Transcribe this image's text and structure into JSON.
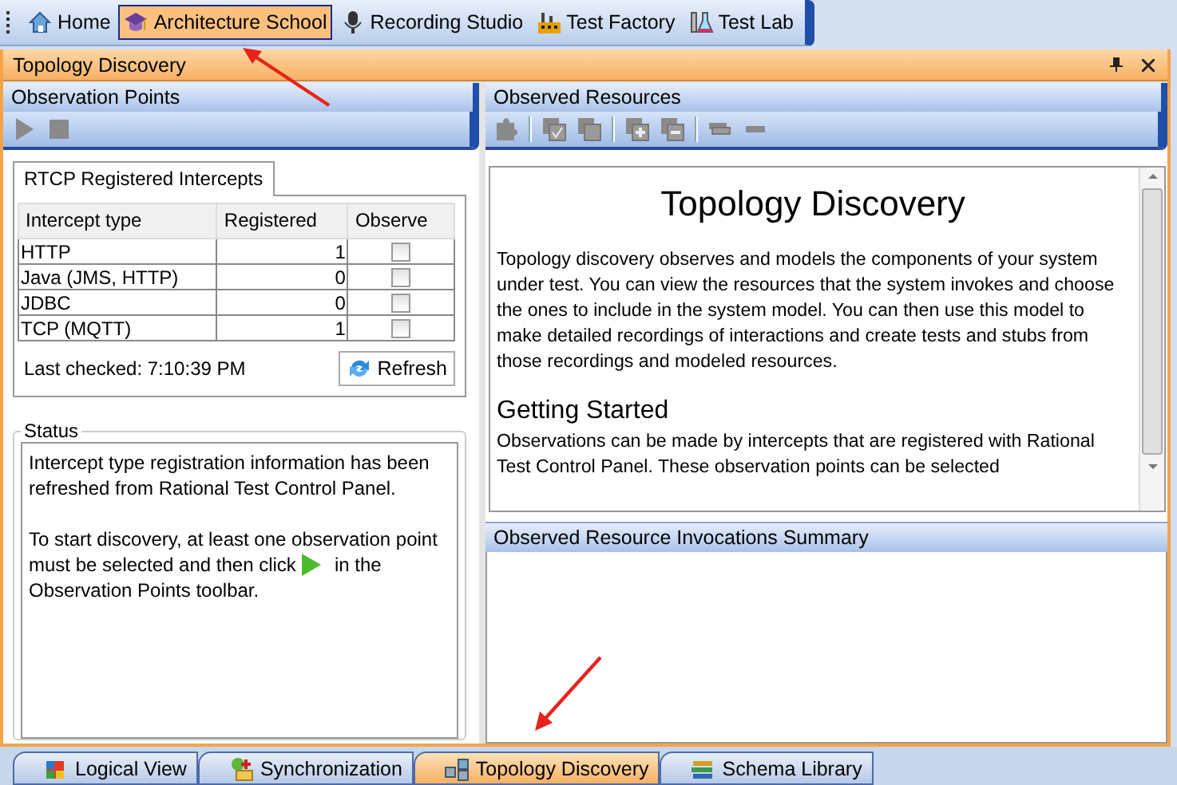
{
  "workspace_tabs": [
    {
      "label": "Home",
      "selected": false
    },
    {
      "label": "Architecture School",
      "selected": true
    },
    {
      "label": "Recording Studio",
      "selected": false
    },
    {
      "label": "Test Factory",
      "selected": false
    },
    {
      "label": "Test Lab",
      "selected": false
    }
  ],
  "view": {
    "title": "Topology Discovery"
  },
  "observation_points": {
    "title": "Observation Points",
    "toolbar": [
      {
        "kind": "play",
        "disabled": true
      },
      {
        "kind": "stop",
        "disabled": true
      }
    ]
  },
  "intercepts": {
    "tab": "RTCP Registered Intercepts",
    "columns": [
      "Intercept type",
      "Registered",
      "Observe"
    ],
    "rows": [
      {
        "type": "HTTP",
        "registered": "1",
        "observe": false
      },
      {
        "type": "Java (JMS, HTTP)",
        "registered": "0",
        "observe": false
      },
      {
        "type": "JDBC",
        "registered": "0",
        "observe": false
      },
      {
        "type": "TCP (MQTT)",
        "registered": "1",
        "observe": false
      }
    ],
    "last_checked": "Last checked: 7:10:39 PM",
    "refresh_button": "Refresh"
  },
  "status": {
    "title": "Status",
    "message": "Intercept type registration information has been refreshed from Rational Test Control Panel.",
    "instruction_line_1": "To start discovery, at least one observation point",
    "instruction_before_icon": "must be selected and then click",
    "instruction_after_icon": "in the",
    "instruction_line_3": "Observation Points toolbar."
  },
  "observed_resources": {
    "title": "Observed Resources",
    "toolbar": [
      [
        {
          "kind": "puzzle",
          "disabled": true
        }
      ],
      [
        {
          "kind": "check",
          "disabled": true
        },
        {
          "kind": "copy",
          "disabled": true
        }
      ],
      [
        {
          "kind": "add",
          "disabled": true
        },
        {
          "kind": "remove",
          "disabled": true
        }
      ],
      [
        {
          "kind": "stack",
          "disabled": true
        },
        {
          "kind": "minus",
          "disabled": true
        }
      ]
    ],
    "document": {
      "heading": "Topology Discovery",
      "intro": "Topology discovery observes and models the components of your system under test. You can view the resources that the system invokes and choose the ones to include in the system model. You can then use this model to make detailed recordings of interactions and create tests and stubs from those recordings and modeled resources.",
      "section_heading": "Getting Started",
      "section_text": "Observations can be made by intercepts that are registered with Rational Test Control Panel. These observation points can be selected"
    }
  },
  "invocations_summary": {
    "title": "Observed Resource Invocations Summary"
  },
  "bottom_tabs": [
    {
      "label": "Logical View",
      "selected": false
    },
    {
      "label": "Synchronization",
      "selected": false
    },
    {
      "label": "Topology Discovery",
      "selected": true
    },
    {
      "label": "Schema Library",
      "selected": false
    }
  ]
}
